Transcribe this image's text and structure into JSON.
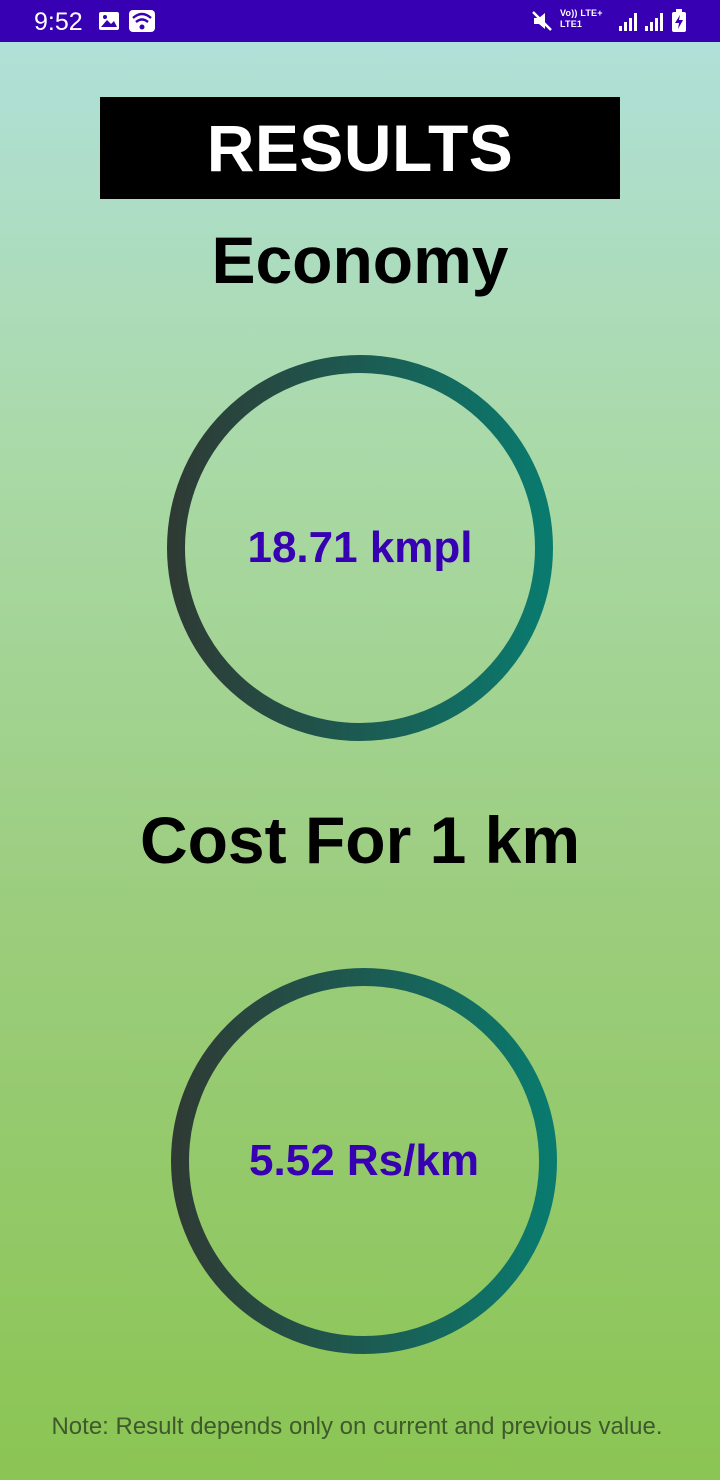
{
  "status_bar": {
    "time": "9:52",
    "network_label_top": "Vo)) LTE+",
    "network_label_bottom": "LTE1",
    "icons": [
      "image-icon",
      "wifi-icon",
      "mute-icon",
      "signal-icon",
      "signal-icon",
      "battery-charging-icon"
    ]
  },
  "header": {
    "title": "RESULTS"
  },
  "economy": {
    "heading": "Economy",
    "value": "18.71 kmpl"
  },
  "cost": {
    "heading": "Cost For 1 km",
    "value": "5.52 Rs/km"
  },
  "footer": {
    "note": "Note: Result depends only on current and previous value."
  },
  "colors": {
    "status_bar": "#3700b3",
    "value_text": "#3700b3",
    "ring_start": "#2e3b35",
    "ring_end": "#0a7a6e",
    "banner": "#000000"
  }
}
